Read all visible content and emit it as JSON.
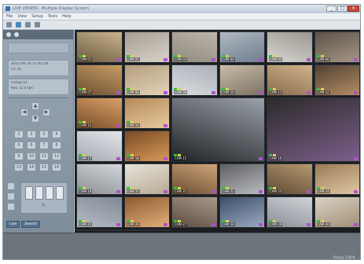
{
  "window": {
    "title": "LIVE VIEWER - Multiple Display System",
    "min_label": "_",
    "max_label": "□",
    "close_label": "×"
  },
  "menu": [
    "File",
    "View",
    "Setup",
    "Tools",
    "Help"
  ],
  "sidebar": {
    "logo_text": "",
    "info_a": [
      "2013.06.24 12:42:30",
      "Ch 16"
    ],
    "info_b": [
      "Group 01",
      "Rec 12.4 fps"
    ],
    "ptz_labels": [
      "◀",
      "▲",
      "▶",
      "▼"
    ],
    "keypad": [
      "1",
      "2",
      "3",
      "4",
      "5",
      "6",
      "7",
      "8",
      "9",
      "10",
      "11",
      "12",
      "13",
      "14",
      "15",
      "16"
    ],
    "layout_sub": "↻",
    "tabs": [
      "Live",
      "Search"
    ]
  },
  "grid": {
    "tiles": [
      {
        "label": "CAM 01",
        "a": "#6b5a3e",
        "b": "#c9b48e"
      },
      {
        "label": "CAM 02",
        "a": "#a79e93",
        "b": "#d8d2c8"
      },
      {
        "label": "CAM 03",
        "a": "#8e8a80",
        "b": "#bdb6a8"
      },
      {
        "label": "CAM 04",
        "a": "#b0b8c2",
        "b": "#6f7e8e"
      },
      {
        "label": "CAM 05",
        "a": "#d9d7d2",
        "b": "#9a9690"
      },
      {
        "label": "CAM 06",
        "a": "#5c5148",
        "b": "#a69886"
      },
      {
        "label": "CAM 07",
        "a": "#6a4f32",
        "b": "#c99d64"
      },
      {
        "label": "CAM 08",
        "a": "#b49d7e",
        "b": "#e3d3b8"
      },
      {
        "label": "CAM 09",
        "a": "#dcdde0",
        "b": "#a9b0b8"
      },
      {
        "label": "CAM 10",
        "a": "#c8bca9",
        "b": "#7d7263"
      },
      {
        "label": "CAM 11",
        "a": "#8a6c4e",
        "b": "#d0b38c"
      },
      {
        "label": "CAM 12",
        "a": "#4f4134",
        "b": "#b58d63"
      },
      {
        "label": "CAM 13",
        "a": "#7a4e2a",
        "b": "#d8a066"
      },
      {
        "label": "CAM 14",
        "a": "#b58a58",
        "b": "#e6caa0"
      },
      {
        "label": "CAM 15",
        "a": "#1f2226",
        "b": "#9aa1a8",
        "big": true
      },
      {
        "label": "CAM 16",
        "a": "#2c2a2a",
        "b": "#7b5f8a",
        "big": true
      },
      {
        "label": "CAM 17",
        "a": "#a3a9b1",
        "b": "#e3e6ea"
      },
      {
        "label": "CAM 18",
        "a": "#7a4a26",
        "b": "#d69a58"
      },
      {
        "label": "CAM 19",
        "a": "#8b8f93",
        "b": "#d3d6da"
      },
      {
        "label": "CAM 20",
        "a": "#e7e3da",
        "b": "#b7aa94"
      },
      {
        "label": "CAM 21",
        "a": "#6b4e33",
        "b": "#cfa57a"
      },
      {
        "label": "CAM 22",
        "a": "#5e5f61",
        "b": "#b9bcc0"
      },
      {
        "label": "CAM 23",
        "a": "#5d4a35",
        "b": "#b5996f"
      },
      {
        "label": "CAM 24",
        "a": "#9a7a57",
        "b": "#e0c7a2"
      },
      {
        "label": "CAM 25",
        "a": "#b6bcc4",
        "b": "#7f8a96"
      },
      {
        "label": "CAM 26",
        "a": "#8c5a30",
        "b": "#e2b07a"
      },
      {
        "label": "CAM 27",
        "a": "#5a4b3f",
        "b": "#a79a8b"
      },
      {
        "label": "CAM 28",
        "a": "#3e4f6a",
        "b": "#9aa9c0"
      },
      {
        "label": "CAM 29",
        "a": "#8b8f95",
        "b": "#cfd3d8"
      },
      {
        "label": "CAM 30",
        "a": "#d8d2c6",
        "b": "#a18f73"
      },
      {
        "label": "CAM 31",
        "a": "#d7cec0",
        "b": "#a07a55"
      },
      {
        "label": "CAM 32",
        "a": "#6a5547",
        "b": "#c9b09a"
      }
    ]
  },
  "status": {
    "text": "Ready   100%"
  }
}
